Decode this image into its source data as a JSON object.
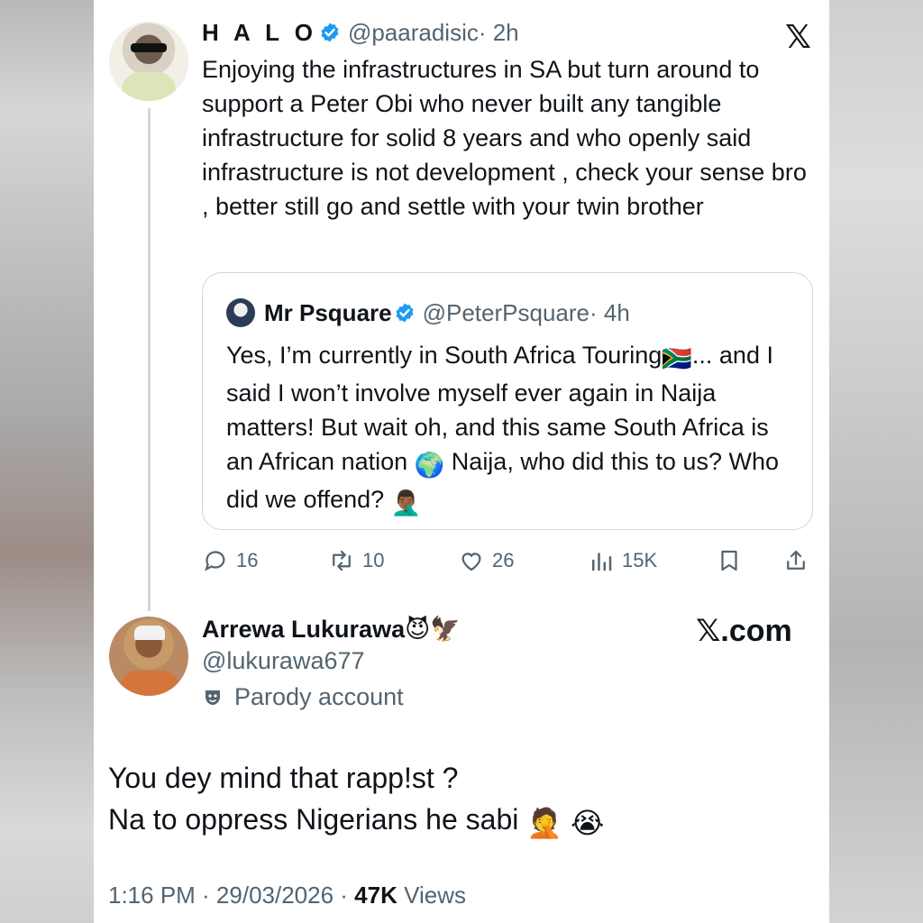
{
  "main_tweet": {
    "display_name": "H A L O",
    "handle": "@paaradisic",
    "time": "· 2h",
    "platform_logo": "𝕏",
    "text": "Enjoying the infrastructures in SA but turn around to support a Peter Obi who never built any tangible infrastructure for solid 8 years and who openly said infrastructure is not development , check your sense bro , better still go and settle with your twin brother"
  },
  "quoted_tweet": {
    "display_name": "Mr Psquare",
    "handle": "@PeterPsquare",
    "time": "· 4h",
    "text_line_1": "Yes, I’m currently in South Africa Touring",
    "flag_emoji": "🇿🇦",
    "text_line_1_end": "...",
    "text_line_2": "and I said I won’t involve myself ever again in Naija matters! But wait oh, and this same South Africa is an African nation",
    "globe_emoji": "🌍",
    "text_line_3": " Naija, who did this to us? Who did we offend?",
    "facepalm_emoji": "🤦🏾‍♂️"
  },
  "actions": {
    "replies": "16",
    "reposts": "10",
    "likes": "26",
    "views": "15K"
  },
  "reply_tweet": {
    "display_name": "Arrewa Lukurawa",
    "name_emojis": "😈🦅",
    "handle": "@lukurawa677",
    "badge": "Parody account",
    "watermark": "𝕏.com",
    "text_line_1": "You dey mind that rapp!st ?",
    "text_line_2": "Na to oppress Nigerians he sabi",
    "text_emojis": "🤦 😭",
    "timestamp": "1:16 PM · 29/03/2026 · ",
    "views_count": "47K",
    "views_label": " Views"
  },
  "colors": {
    "text": "#0f1419",
    "secondary": "#536471",
    "verified_blue": "#1d9bf0",
    "border": "#cfd9de"
  },
  "icons": [
    "verified-badge-icon",
    "x-logo-icon",
    "reply-icon",
    "repost-icon",
    "like-icon",
    "views-icon",
    "bookmark-icon",
    "share-icon",
    "parody-mask-icon"
  ]
}
